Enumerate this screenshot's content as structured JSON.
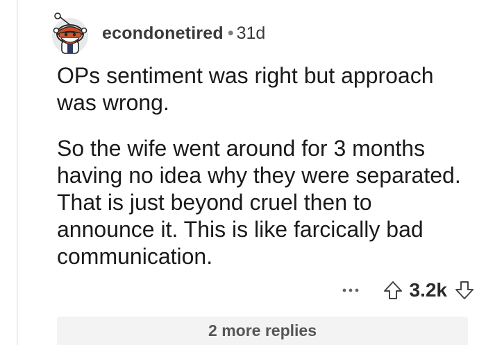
{
  "comment": {
    "username": "econdonetired",
    "separator": "•",
    "age": "31d",
    "paragraphs": [
      "OPs sentiment was right but approach was wrong.",
      "So the wife went around for 3 months having no idea why they were separated.  That is just beyond cruel then to announce it.  This is like farcically bad communication."
    ],
    "score": "3.2k",
    "more_replies_label": "2 more replies"
  },
  "icons": {
    "avatar": "snoo-avatar",
    "more": "ellipsis-icon",
    "upvote": "upvote-arrow-icon",
    "downvote": "downvote-arrow-icon"
  }
}
